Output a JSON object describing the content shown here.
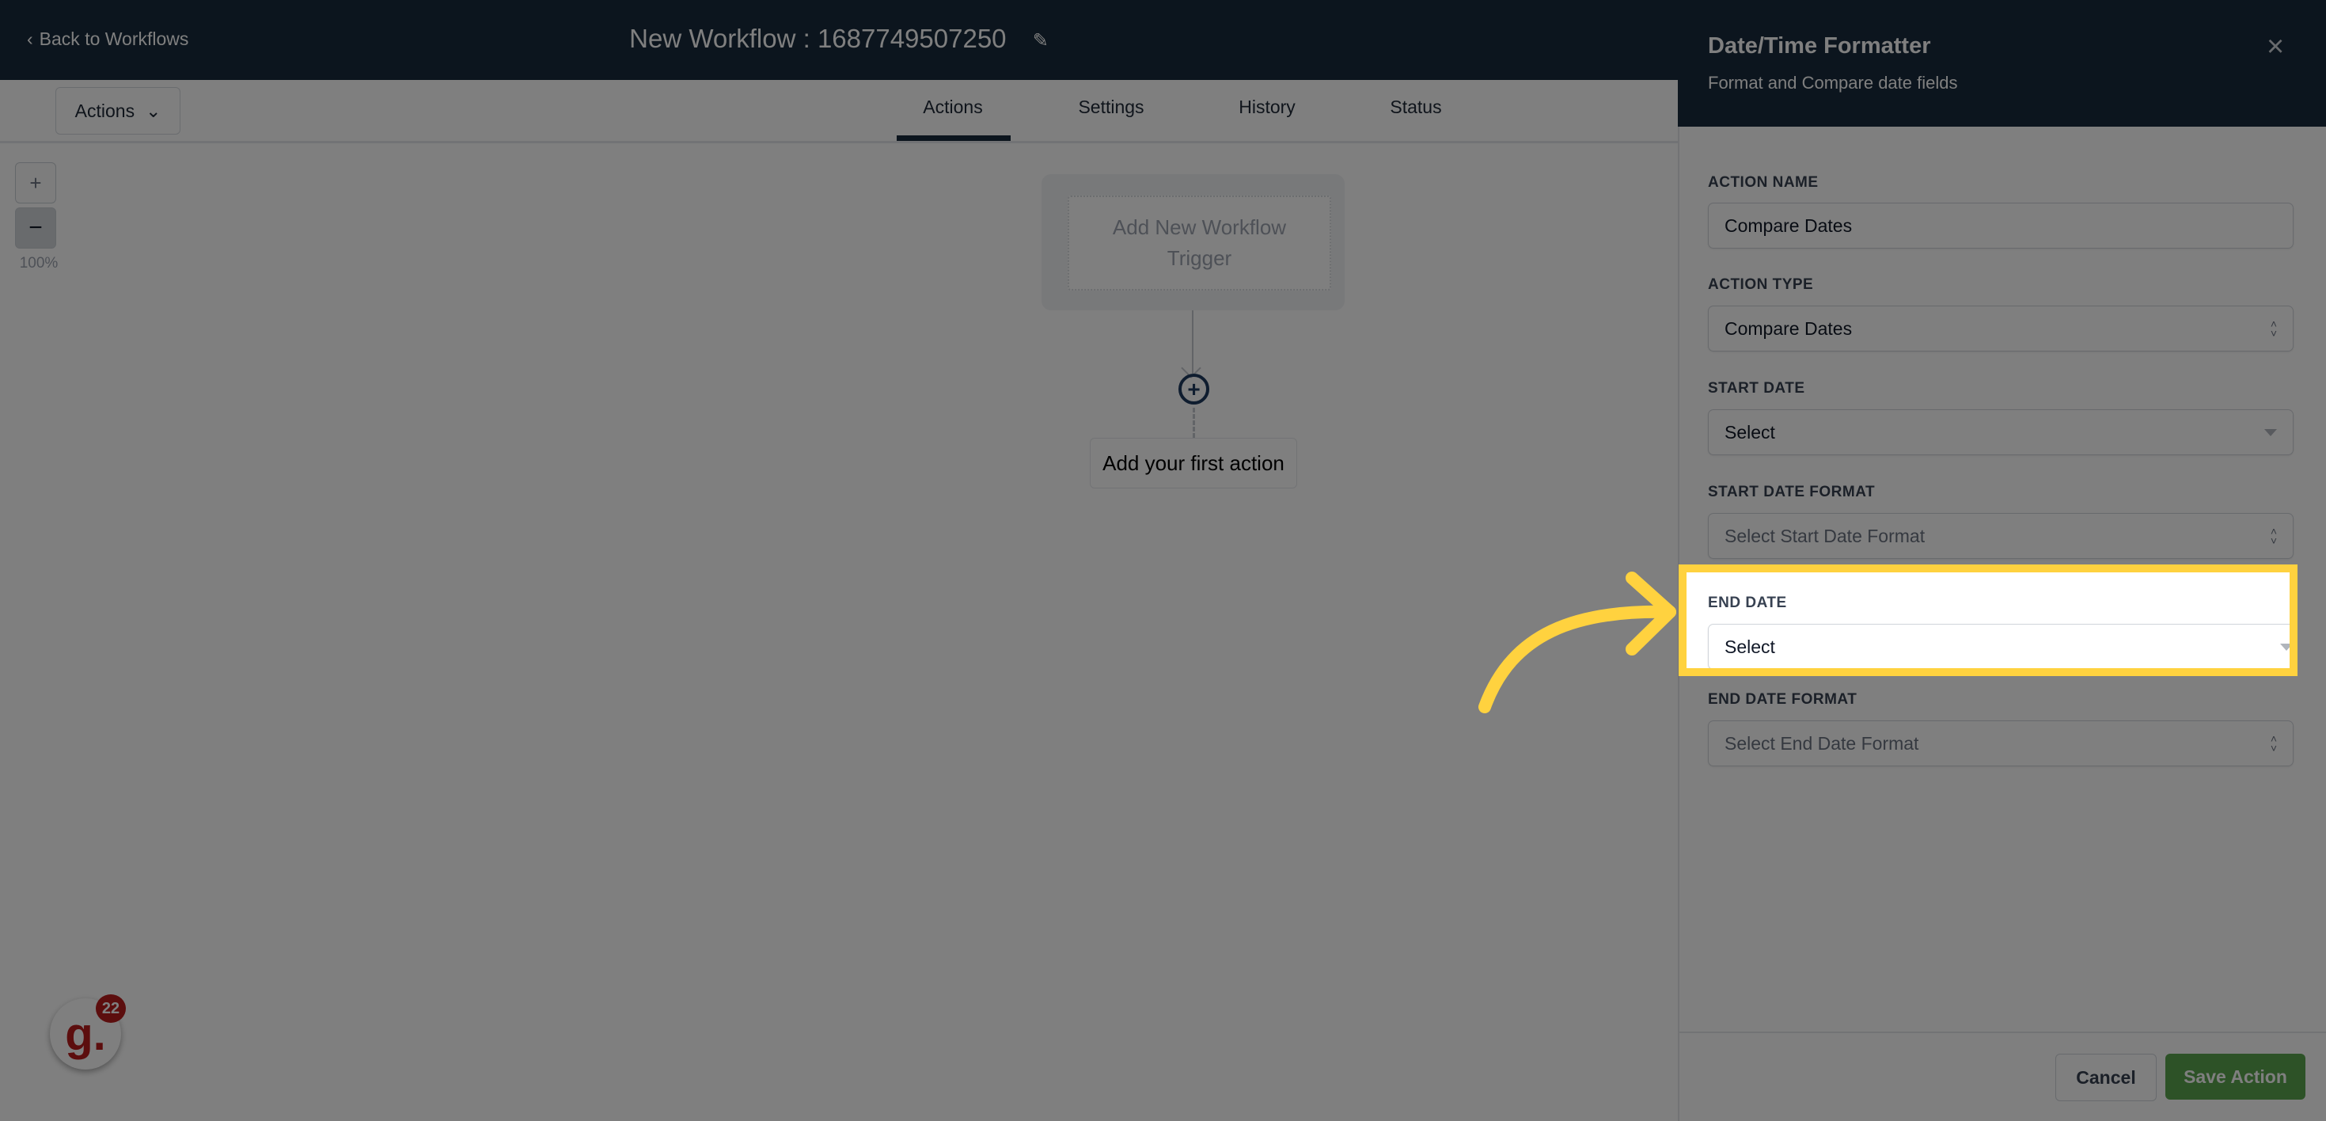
{
  "topbar": {
    "back_label": "Back to Workflows",
    "workflow_title": "New Workflow : 1687749507250",
    "edit_icon": "pencil-icon"
  },
  "subnav": {
    "actions_dropdown": "Actions",
    "tabs": [
      {
        "label": "Actions",
        "active": true
      },
      {
        "label": "Settings",
        "active": false
      },
      {
        "label": "History",
        "active": false
      },
      {
        "label": "Status",
        "active": false
      }
    ]
  },
  "canvas": {
    "zoom_in": "+",
    "zoom_out": "−",
    "zoom_level": "100%",
    "trigger_card": "Add New Workflow Trigger",
    "add_action_icon": "plus-circle-icon",
    "first_action": "Add your first action"
  },
  "badge": {
    "logo_letter": "g.",
    "count": "22"
  },
  "panel": {
    "title": "Date/Time Formatter",
    "subtitle": "Format and Compare date fields",
    "close_icon": "×",
    "fields": {
      "action_name": {
        "label": "ACTION NAME",
        "value": "Compare Dates"
      },
      "action_type": {
        "label": "ACTION TYPE",
        "value": "Compare Dates"
      },
      "start_date": {
        "label": "START DATE",
        "placeholder": "Select"
      },
      "start_date_format": {
        "label": "START DATE FORMAT",
        "placeholder": "Select Start Date Format"
      },
      "end_date": {
        "label": "END DATE",
        "placeholder": "Select"
      },
      "end_date_format": {
        "label": "END DATE FORMAT",
        "placeholder": "Select End Date Format"
      }
    },
    "cancel_label": "Cancel",
    "save_label": "Save Action"
  },
  "annotation": {
    "highlight_color": "#ffd23f",
    "target": "END DATE"
  },
  "colors": {
    "header_bg": "#192b3c",
    "save_green": "#5aa54f",
    "badge_red": "#b91c1c"
  }
}
